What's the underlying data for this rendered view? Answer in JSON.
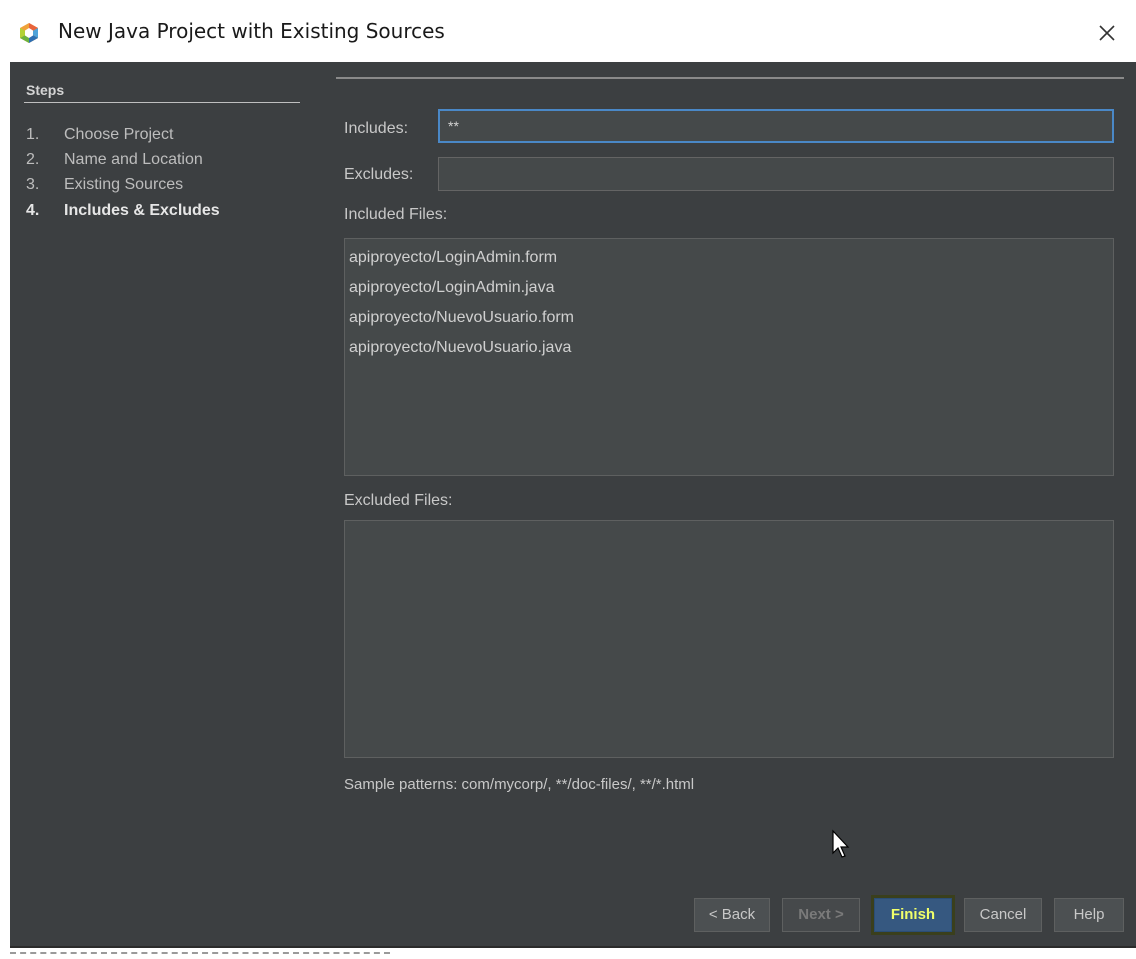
{
  "window": {
    "title": "New Java Project with Existing Sources",
    "close_symbol": "×"
  },
  "steps": {
    "heading": "Steps",
    "items": [
      {
        "num": "1.",
        "label": "Choose Project",
        "active": false
      },
      {
        "num": "2.",
        "label": "Name and Location",
        "active": false
      },
      {
        "num": "3.",
        "label": "Existing Sources",
        "active": false
      },
      {
        "num": "4.",
        "label": "Includes & Excludes",
        "active": true
      }
    ]
  },
  "form": {
    "includes_label": "Includes:",
    "includes_value": "**",
    "excludes_label": "Excludes:",
    "excludes_value": "",
    "included_files_label": "Included Files:",
    "included_files": [
      "apiproyecto/LoginAdmin.form",
      "apiproyecto/LoginAdmin.java",
      "apiproyecto/NuevoUsuario.form",
      "apiproyecto/NuevoUsuario.java"
    ],
    "excluded_files_label": "Excluded Files:",
    "excluded_files": [],
    "sample_patterns": "Sample patterns: com/mycorp/, **/doc-files/, **/*.html"
  },
  "buttons": {
    "back": "< Back",
    "next": "Next >",
    "finish": "Finish",
    "cancel": "Cancel",
    "help": "Help"
  },
  "colors": {
    "dialog_bg": "#3c3f41",
    "field_bg": "#45494a",
    "focus_border": "#4a88c7",
    "finish_text": "#f0ff6a"
  }
}
